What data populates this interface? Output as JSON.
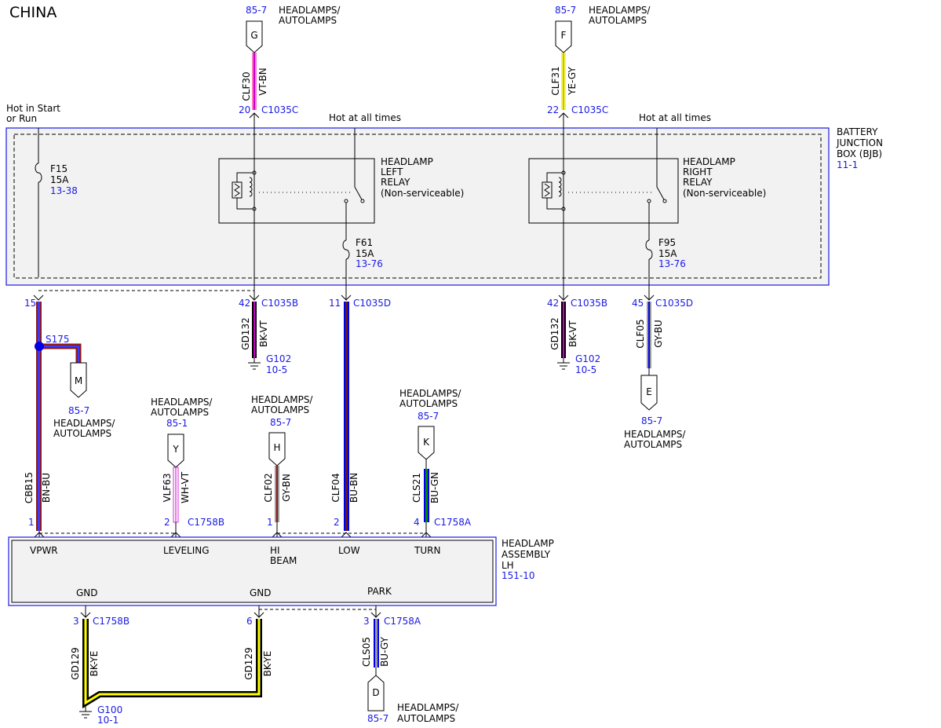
{
  "title": "CHINA",
  "bjb": {
    "line1": "BATTERY",
    "line2": "JUNCTION",
    "line3": "BOX (BJB)",
    "ref": "11-1"
  },
  "hot_start_run": {
    "line1": "Hot in Start",
    "line2": "or Run"
  },
  "hot_all_times_1": "Hot at all times",
  "hot_all_times_2": "Hot at all times",
  "fuses": {
    "f15": {
      "name": "F15",
      "rating": "15A",
      "ref": "13-38"
    },
    "f61": {
      "name": "F61",
      "rating": "15A",
      "ref": "13-76"
    },
    "f95": {
      "name": "F95",
      "rating": "15A",
      "ref": "13-76"
    }
  },
  "relays": {
    "left": {
      "line1": "HEADLAMP",
      "line2": "LEFT",
      "line3": "RELAY",
      "line4": "(Non-serviceable)"
    },
    "right": {
      "line1": "HEADLAMP",
      "line2": "RIGHT",
      "line3": "RELAY",
      "line4": "(Non-serviceable)"
    }
  },
  "top_connectors": {
    "g": {
      "letter": "G",
      "ref": "85-7",
      "line1": "HEADLAMPS/",
      "line2": "AUTOLAMPS",
      "circuit": "CLF30",
      "color": "VT-BN",
      "pin": "20",
      "connector": "C1035C"
    },
    "f": {
      "letter": "F",
      "ref": "85-7",
      "line1": "HEADLAMPS/",
      "line2": "AUTOLAMPS",
      "circuit": "CLF31",
      "color": "YE-GY",
      "pin": "22",
      "connector": "C1035C"
    }
  },
  "bjb_outputs": {
    "p15": {
      "pin": "15"
    },
    "p42a": {
      "pin": "42",
      "connector": "C1035B",
      "circuit": "GD132",
      "color": "BK-VT",
      "ground": "G102",
      "ground_ref": "10-5"
    },
    "p11": {
      "pin": "11",
      "connector": "C1035D"
    },
    "p42b": {
      "pin": "42",
      "connector": "C1035B",
      "circuit": "GD132",
      "color": "BK-VT",
      "ground": "G102",
      "ground_ref": "10-5"
    },
    "p45": {
      "pin": "45",
      "connector": "C1035D",
      "circuit": "CLF05",
      "color": "GY-BU"
    }
  },
  "splice": {
    "name": "S175"
  },
  "mid_connectors": {
    "m": {
      "letter": "M",
      "ref": "85-7",
      "line1": "HEADLAMPS/",
      "line2": "AUTOLAMPS"
    },
    "e": {
      "letter": "E",
      "ref": "85-7",
      "line1": "HEADLAMPS/",
      "line2": "AUTOLAMPS"
    },
    "y": {
      "letter": "Y",
      "ref": "85-1",
      "line1": "HEADLAMPS/",
      "line2": "AUTOLAMPS",
      "circuit": "VLF63",
      "color": "WH-VT"
    },
    "h": {
      "letter": "H",
      "ref": "85-7",
      "line1": "HEADLAMPS/",
      "line2": "AUTOLAMPS",
      "circuit": "CLF02",
      "color": "GY-BN"
    },
    "k": {
      "letter": "K",
      "ref": "85-7",
      "line1": "HEADLAMPS/",
      "line2": "AUTOLAMPS",
      "circuit": "CLS21",
      "color": "BU-GN"
    }
  },
  "wires": {
    "cbb15": {
      "circuit": "CBB15",
      "color": "BN-BU"
    },
    "clf04": {
      "circuit": "CLF04",
      "color": "BU-BN"
    }
  },
  "assembly_pins": {
    "vpwr": {
      "pin": "1"
    },
    "leveling": {
      "pin": "2",
      "connector": "C1758B"
    },
    "hibeam": {
      "pin": "1"
    },
    "low": {
      "pin": "2"
    },
    "turn": {
      "pin": "4",
      "connector": "C1758A"
    }
  },
  "assembly": {
    "line1": "HEADLAMP",
    "line2": "ASSEMBLY",
    "line3": "LH",
    "ref": "151-10",
    "vpwr": "VPWR",
    "leveling": "LEVELING",
    "hi1": "HI",
    "hi2": "BEAM",
    "low": "LOW",
    "turn": "TURN",
    "gnd1": "GND",
    "gnd2": "GND",
    "park": "PARK"
  },
  "bottom": {
    "p3": {
      "pin": "3",
      "connector": "C1758B"
    },
    "p6": {
      "pin": "6"
    },
    "p3b": {
      "pin": "3",
      "connector": "C1758A"
    },
    "gd129a": {
      "circuit": "GD129",
      "color": "BK-YE"
    },
    "gd129b": {
      "circuit": "GD129",
      "color": "BK-YE"
    },
    "ground": {
      "name": "G100",
      "ref": "10-1"
    },
    "cls05": {
      "circuit": "CLS05",
      "color": "BU-GY"
    },
    "d": {
      "letter": "D",
      "ref": "85-7",
      "line1": "HEADLAMPS/",
      "line2": "AUTOLAMPS"
    }
  },
  "colors": {
    "violet": "#c800c8",
    "pink": "#ff78c8",
    "yellow": "#ffff00",
    "brown": "#8b1a1a",
    "blue": "#0000e6",
    "gray": "#9a9a9a",
    "black": "#000000",
    "white": "#ffffff",
    "green": "#008c00",
    "label_blue": "#1a1ae6"
  }
}
